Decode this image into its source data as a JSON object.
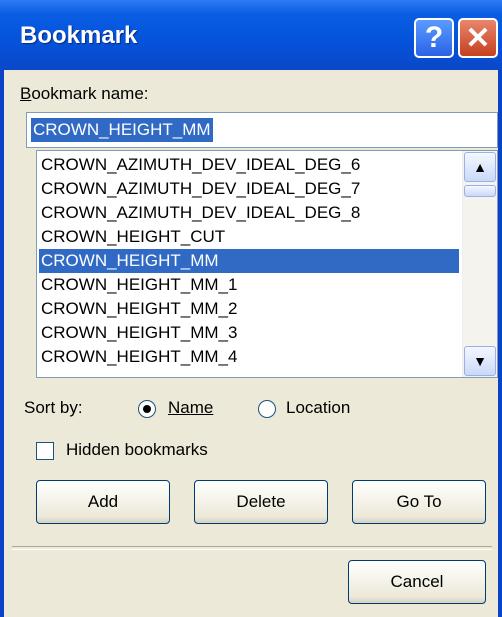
{
  "window": {
    "title": "Bookmark",
    "help_label": "?",
    "close_label": "✕"
  },
  "form": {
    "name_label": "Bookmark name:",
    "name_value": "CROWN_HEIGHT_MM",
    "list_items": [
      "CROWN_AZIMUTH_DEV_IDEAL_DEG_6",
      "CROWN_AZIMUTH_DEV_IDEAL_DEG_7",
      "CROWN_AZIMUTH_DEV_IDEAL_DEG_8",
      "CROWN_HEIGHT_CUT",
      "CROWN_HEIGHT_MM",
      "CROWN_HEIGHT_MM_1",
      "CROWN_HEIGHT_MM_2",
      "CROWN_HEIGHT_MM_3",
      "CROWN_HEIGHT_MM_4"
    ],
    "selected_index": 4,
    "sort_label": "Sort by:",
    "sort_name": "Name",
    "sort_location": "Location",
    "sort_selected": "Name",
    "hidden_label": "Hidden bookmarks",
    "hidden_checked": false
  },
  "buttons": {
    "add": "Add",
    "delete": "Delete",
    "goto": "Go To",
    "cancel": "Cancel"
  },
  "icons": {
    "scroll_up": "▲",
    "scroll_down": "▼"
  }
}
